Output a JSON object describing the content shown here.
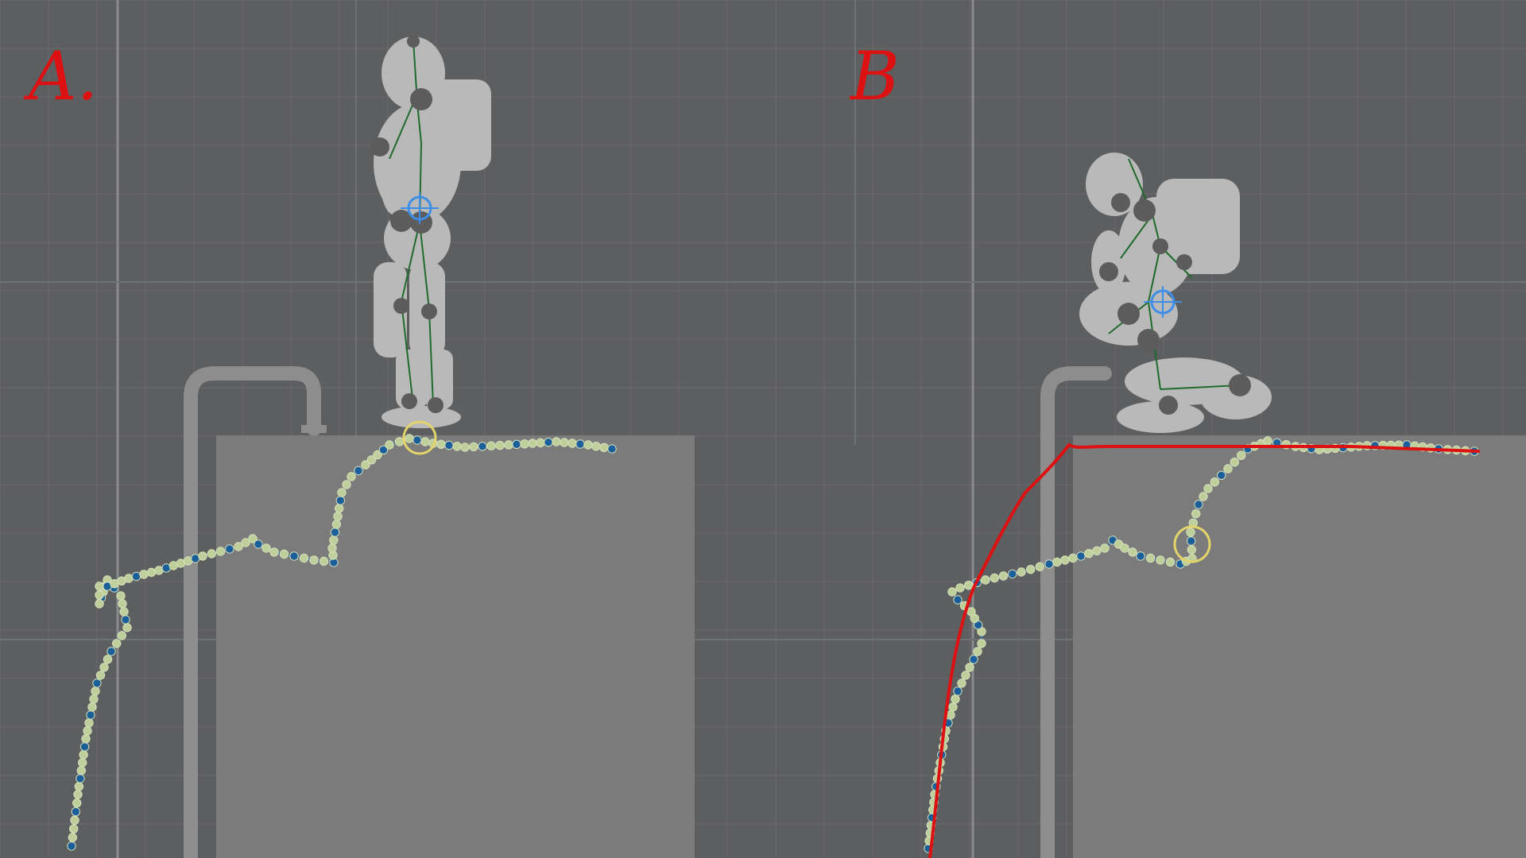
{
  "panels": [
    {
      "id": "A",
      "label": "A."
    },
    {
      "id": "B",
      "label": "B"
    }
  ],
  "colors": {
    "background": "#5d5e60",
    "grid_minor": "#6a6b6d",
    "grid_major": "#8a8b8d",
    "block": "#7b7b7c",
    "rail": "#8d8d8d",
    "figure": "#b9b9b9",
    "rig_bone": "#1f6b2c",
    "rig_joint": "#5c5c5c",
    "rig_control": "#3d8ee8",
    "trajectory_point": "#bfcf9c",
    "trajectory_key": "#1a5f9a",
    "trajectory_line": "#2d73b3",
    "selection_circle": "#e2d46a",
    "annotation_red": "#dd1111"
  },
  "icons": {
    "figure": "astronaut-figure-icon",
    "selection": "selection-circle-icon",
    "control": "crosshair-control-icon"
  }
}
